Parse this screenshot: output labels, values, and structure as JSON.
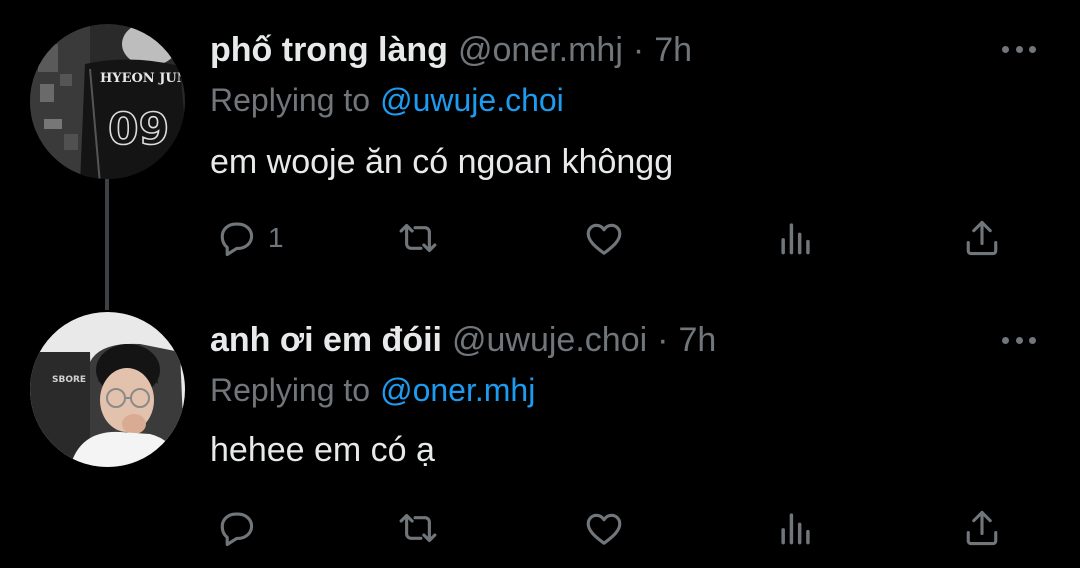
{
  "tweets": [
    {
      "display_name": "phố trong làng",
      "handle": "@oner.mhj",
      "separator": "·",
      "time": "7h",
      "replying_label": "Replying to",
      "replying_to": "@uwuje.choi",
      "text": "em wooje ăn có ngoan khôngg",
      "reply_count": "1",
      "avatar_jersey_name": "HYEON JUN",
      "avatar_jersey_number": "09"
    },
    {
      "display_name": "anh ơi em đóii",
      "handle": "@uwuje.choi",
      "separator": "·",
      "time": "7h",
      "replying_label": "Replying to",
      "replying_to": "@oner.mhj",
      "text": "hehee em có ạ",
      "reply_count": "",
      "avatar_chair_text": "SBORE"
    }
  ],
  "colors": {
    "background": "#000000",
    "primary_text": "#e7e9ea",
    "secondary_text": "#71767b",
    "accent": "#1d9bf0",
    "thread_line": "#3e4144"
  },
  "icons": [
    "reply-icon",
    "retweet-icon",
    "like-icon",
    "views-icon",
    "share-icon",
    "more-icon"
  ]
}
